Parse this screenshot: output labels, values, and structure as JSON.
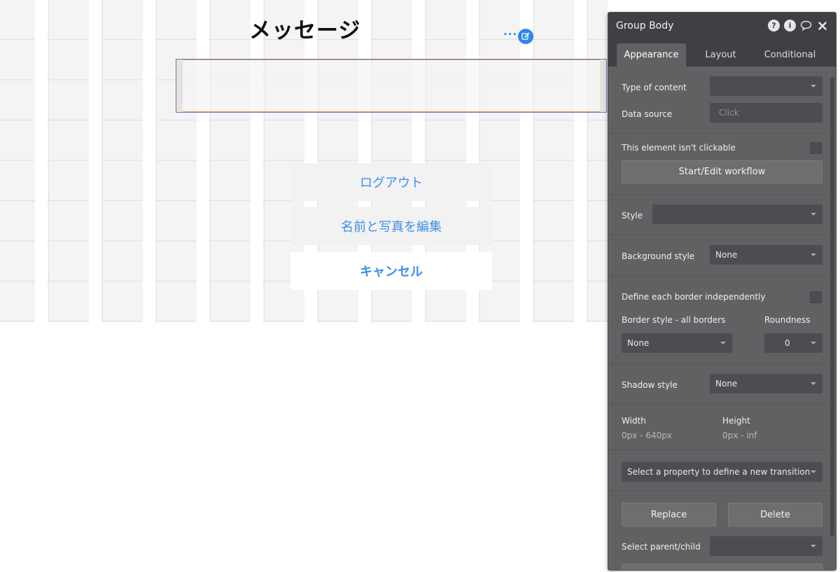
{
  "canvas": {
    "page_title": "メッセージ",
    "dots": "···",
    "buttons": {
      "logout": "ログアウト",
      "edit_profile": "名前と写真を編集",
      "cancel": "キャンセル"
    },
    "accent_color": "#2f86eb"
  },
  "panel": {
    "title": "Group Body",
    "header_icons": [
      "help-icon",
      "info-icon",
      "comment-icon",
      "close-icon"
    ],
    "tabs": [
      {
        "label": "Appearance",
        "active": true
      },
      {
        "label": "Layout",
        "active": false
      },
      {
        "label": "Conditional",
        "active": false
      }
    ],
    "type_of_content": {
      "label": "Type of content",
      "value": ""
    },
    "data_source": {
      "label": "Data source",
      "placeholder": "Click"
    },
    "not_clickable": {
      "label": "This element isn't clickable"
    },
    "workflow_button": "Start/Edit workflow",
    "style": {
      "label": "Style",
      "value": ""
    },
    "background_style": {
      "label": "Background style",
      "value": "None"
    },
    "define_border": {
      "label": "Define each border independently"
    },
    "border_style": {
      "label": "Border style - all borders",
      "value": "None"
    },
    "roundness": {
      "label": "Roundness",
      "value": "0"
    },
    "shadow_style": {
      "label": "Shadow style",
      "value": "None"
    },
    "width": {
      "label": "Width",
      "value": "0px - 640px"
    },
    "height": {
      "label": "Height",
      "value": "0px - inf"
    },
    "transition": {
      "value": "Select a property to define a new transition"
    },
    "replace_button": "Replace",
    "delete_button": "Delete",
    "parent_child": {
      "label": "Select parent/child",
      "value": ""
    }
  }
}
